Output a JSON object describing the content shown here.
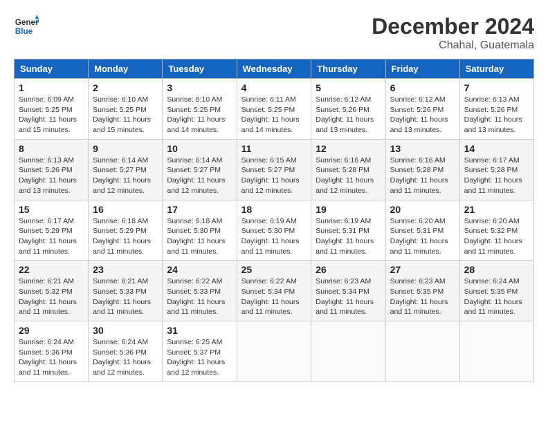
{
  "header": {
    "logo_general": "General",
    "logo_blue": "Blue",
    "month_title": "December 2024",
    "location": "Chahal, Guatemala"
  },
  "weekdays": [
    "Sunday",
    "Monday",
    "Tuesday",
    "Wednesday",
    "Thursday",
    "Friday",
    "Saturday"
  ],
  "weeks": [
    [
      {
        "day": "1",
        "sunrise": "Sunrise: 6:09 AM",
        "sunset": "Sunset: 5:25 PM",
        "daylight": "Daylight: 11 hours and 15 minutes."
      },
      {
        "day": "2",
        "sunrise": "Sunrise: 6:10 AM",
        "sunset": "Sunset: 5:25 PM",
        "daylight": "Daylight: 11 hours and 15 minutes."
      },
      {
        "day": "3",
        "sunrise": "Sunrise: 6:10 AM",
        "sunset": "Sunset: 5:25 PM",
        "daylight": "Daylight: 11 hours and 14 minutes."
      },
      {
        "day": "4",
        "sunrise": "Sunrise: 6:11 AM",
        "sunset": "Sunset: 5:25 PM",
        "daylight": "Daylight: 11 hours and 14 minutes."
      },
      {
        "day": "5",
        "sunrise": "Sunrise: 6:12 AM",
        "sunset": "Sunset: 5:26 PM",
        "daylight": "Daylight: 11 hours and 13 minutes."
      },
      {
        "day": "6",
        "sunrise": "Sunrise: 6:12 AM",
        "sunset": "Sunset: 5:26 PM",
        "daylight": "Daylight: 11 hours and 13 minutes."
      },
      {
        "day": "7",
        "sunrise": "Sunrise: 6:13 AM",
        "sunset": "Sunset: 5:26 PM",
        "daylight": "Daylight: 11 hours and 13 minutes."
      }
    ],
    [
      {
        "day": "8",
        "sunrise": "Sunrise: 6:13 AM",
        "sunset": "Sunset: 5:26 PM",
        "daylight": "Daylight: 11 hours and 13 minutes."
      },
      {
        "day": "9",
        "sunrise": "Sunrise: 6:14 AM",
        "sunset": "Sunset: 5:27 PM",
        "daylight": "Daylight: 11 hours and 12 minutes."
      },
      {
        "day": "10",
        "sunrise": "Sunrise: 6:14 AM",
        "sunset": "Sunset: 5:27 PM",
        "daylight": "Daylight: 11 hours and 12 minutes."
      },
      {
        "day": "11",
        "sunrise": "Sunrise: 6:15 AM",
        "sunset": "Sunset: 5:27 PM",
        "daylight": "Daylight: 11 hours and 12 minutes."
      },
      {
        "day": "12",
        "sunrise": "Sunrise: 6:16 AM",
        "sunset": "Sunset: 5:28 PM",
        "daylight": "Daylight: 11 hours and 12 minutes."
      },
      {
        "day": "13",
        "sunrise": "Sunrise: 6:16 AM",
        "sunset": "Sunset: 5:28 PM",
        "daylight": "Daylight: 11 hours and 11 minutes."
      },
      {
        "day": "14",
        "sunrise": "Sunrise: 6:17 AM",
        "sunset": "Sunset: 5:28 PM",
        "daylight": "Daylight: 11 hours and 11 minutes."
      }
    ],
    [
      {
        "day": "15",
        "sunrise": "Sunrise: 6:17 AM",
        "sunset": "Sunset: 5:29 PM",
        "daylight": "Daylight: 11 hours and 11 minutes."
      },
      {
        "day": "16",
        "sunrise": "Sunrise: 6:18 AM",
        "sunset": "Sunset: 5:29 PM",
        "daylight": "Daylight: 11 hours and 11 minutes."
      },
      {
        "day": "17",
        "sunrise": "Sunrise: 6:18 AM",
        "sunset": "Sunset: 5:30 PM",
        "daylight": "Daylight: 11 hours and 11 minutes."
      },
      {
        "day": "18",
        "sunrise": "Sunrise: 6:19 AM",
        "sunset": "Sunset: 5:30 PM",
        "daylight": "Daylight: 11 hours and 11 minutes."
      },
      {
        "day": "19",
        "sunrise": "Sunrise: 6:19 AM",
        "sunset": "Sunset: 5:31 PM",
        "daylight": "Daylight: 11 hours and 11 minutes."
      },
      {
        "day": "20",
        "sunrise": "Sunrise: 6:20 AM",
        "sunset": "Sunset: 5:31 PM",
        "daylight": "Daylight: 11 hours and 11 minutes."
      },
      {
        "day": "21",
        "sunrise": "Sunrise: 6:20 AM",
        "sunset": "Sunset: 5:32 PM",
        "daylight": "Daylight: 11 hours and 11 minutes."
      }
    ],
    [
      {
        "day": "22",
        "sunrise": "Sunrise: 6:21 AM",
        "sunset": "Sunset: 5:32 PM",
        "daylight": "Daylight: 11 hours and 11 minutes."
      },
      {
        "day": "23",
        "sunrise": "Sunrise: 6:21 AM",
        "sunset": "Sunset: 5:33 PM",
        "daylight": "Daylight: 11 hours and 11 minutes."
      },
      {
        "day": "24",
        "sunrise": "Sunrise: 6:22 AM",
        "sunset": "Sunset: 5:33 PM",
        "daylight": "Daylight: 11 hours and 11 minutes."
      },
      {
        "day": "25",
        "sunrise": "Sunrise: 6:22 AM",
        "sunset": "Sunset: 5:34 PM",
        "daylight": "Daylight: 11 hours and 11 minutes."
      },
      {
        "day": "26",
        "sunrise": "Sunrise: 6:23 AM",
        "sunset": "Sunset: 5:34 PM",
        "daylight": "Daylight: 11 hours and 11 minutes."
      },
      {
        "day": "27",
        "sunrise": "Sunrise: 6:23 AM",
        "sunset": "Sunset: 5:35 PM",
        "daylight": "Daylight: 11 hours and 11 minutes."
      },
      {
        "day": "28",
        "sunrise": "Sunrise: 6:24 AM",
        "sunset": "Sunset: 5:35 PM",
        "daylight": "Daylight: 11 hours and 11 minutes."
      }
    ],
    [
      {
        "day": "29",
        "sunrise": "Sunrise: 6:24 AM",
        "sunset": "Sunset: 5:36 PM",
        "daylight": "Daylight: 11 hours and 11 minutes."
      },
      {
        "day": "30",
        "sunrise": "Sunrise: 6:24 AM",
        "sunset": "Sunset: 5:36 PM",
        "daylight": "Daylight: 11 hours and 12 minutes."
      },
      {
        "day": "31",
        "sunrise": "Sunrise: 6:25 AM",
        "sunset": "Sunset: 5:37 PM",
        "daylight": "Daylight: 11 hours and 12 minutes."
      },
      null,
      null,
      null,
      null
    ]
  ]
}
